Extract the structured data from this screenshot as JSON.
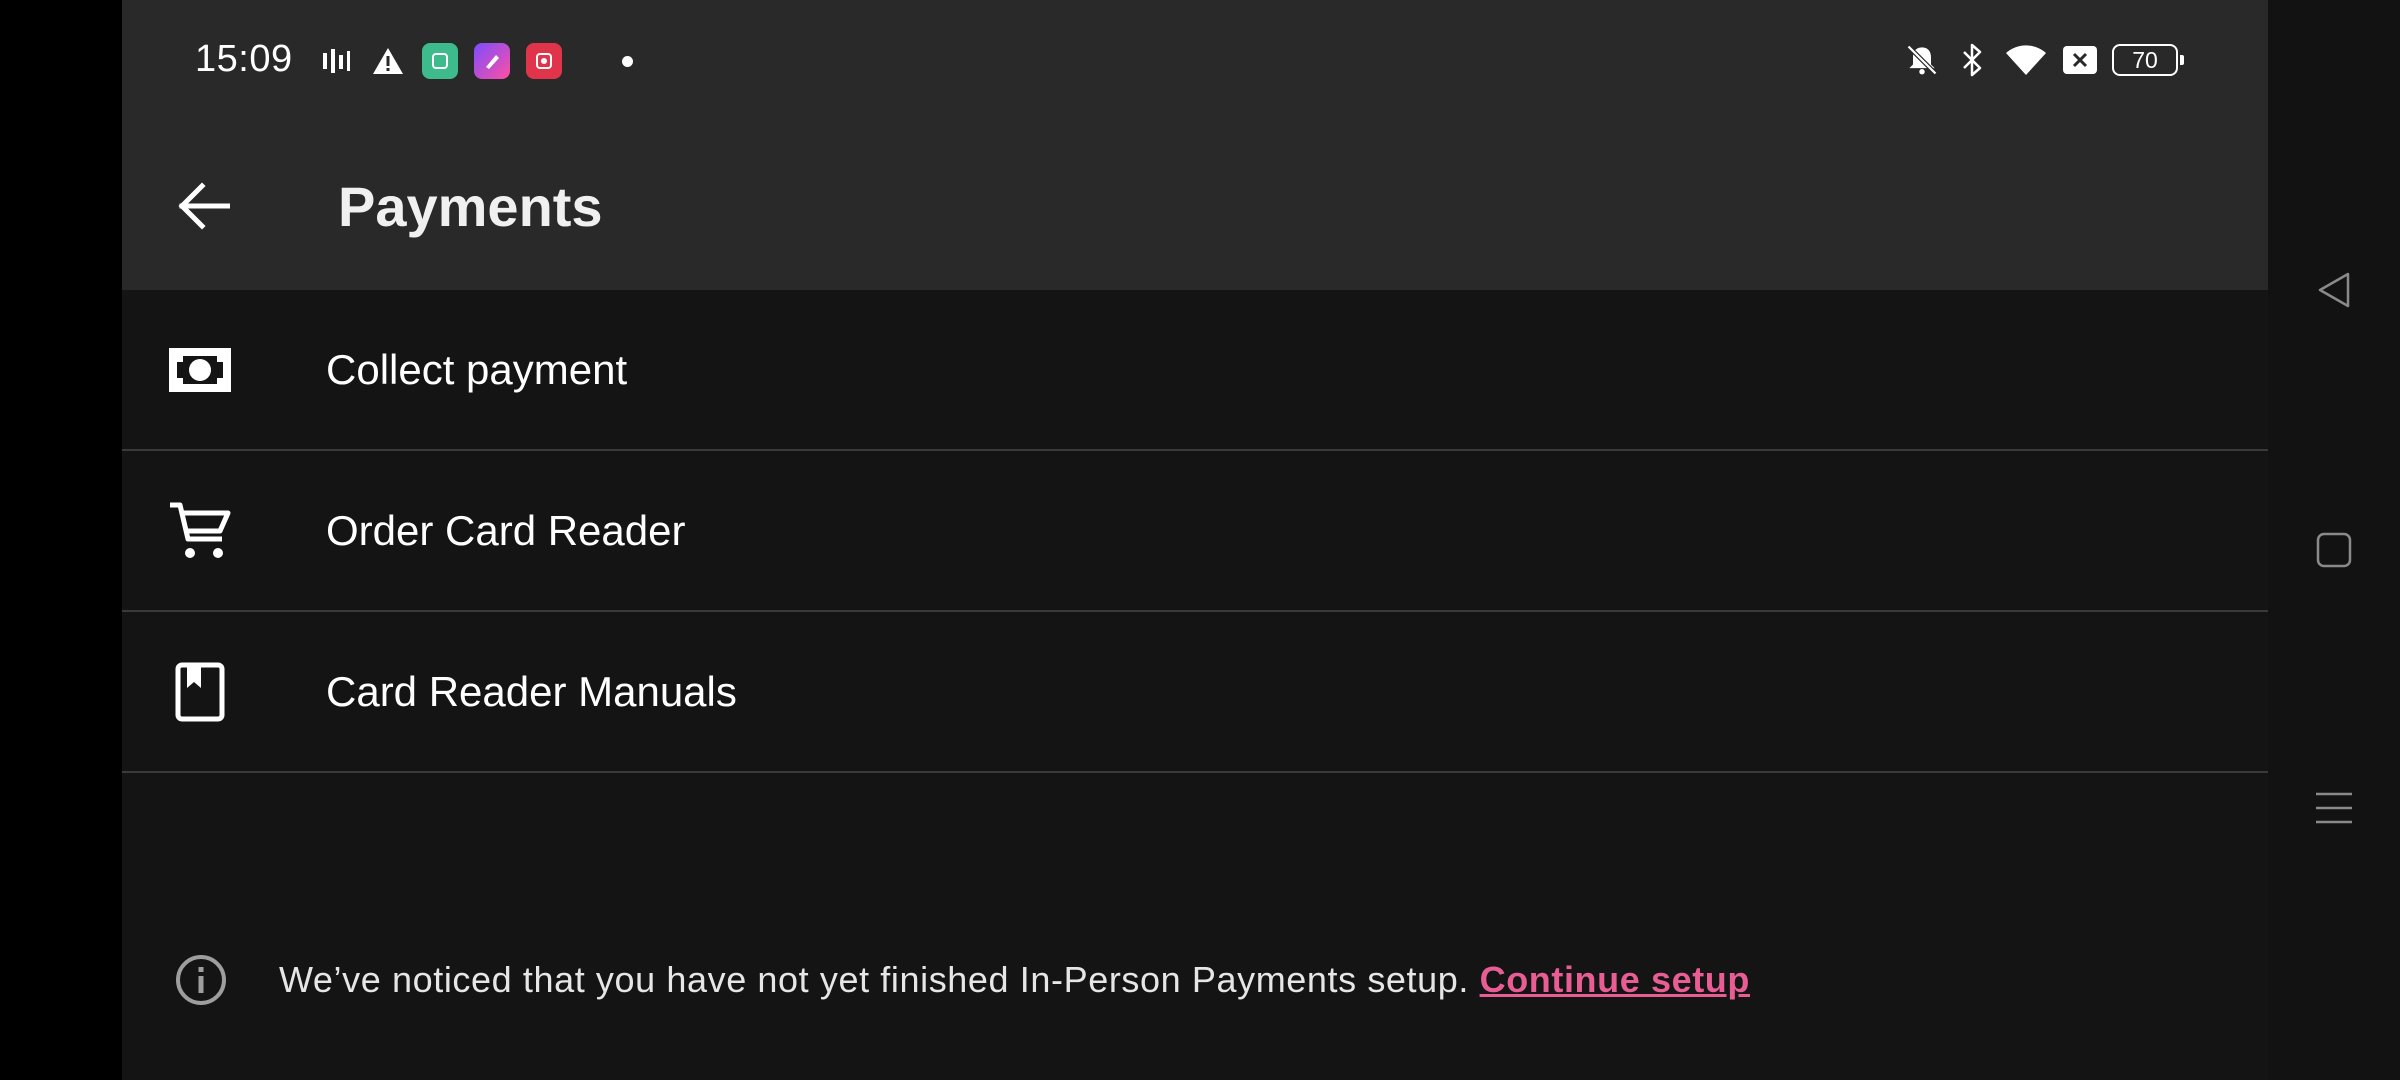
{
  "status_bar": {
    "time": "15:09",
    "left_icons": [
      "activity-icon",
      "warning-icon",
      "app-notification-icon",
      "app-notification-icon",
      "app-notification-icon"
    ],
    "right_icons": [
      "mute-icon",
      "bluetooth-icon",
      "wifi-icon",
      "sim-off-icon"
    ],
    "battery_level": "70"
  },
  "toolbar": {
    "title": "Payments"
  },
  "menu": {
    "items": [
      {
        "label": "Collect payment",
        "icon": "cash-icon"
      },
      {
        "label": "Order Card Reader",
        "icon": "cart-icon"
      },
      {
        "label": "Card Reader Manuals",
        "icon": "book-icon"
      }
    ]
  },
  "notice": {
    "text": "We’ve noticed that you have not yet finished In-Person Payments setup. ",
    "link_label": "Continue setup"
  },
  "colors": {
    "background": "#141414",
    "toolbar": "#292929",
    "link": "#e85d93",
    "divider": "#3a3a3a"
  }
}
